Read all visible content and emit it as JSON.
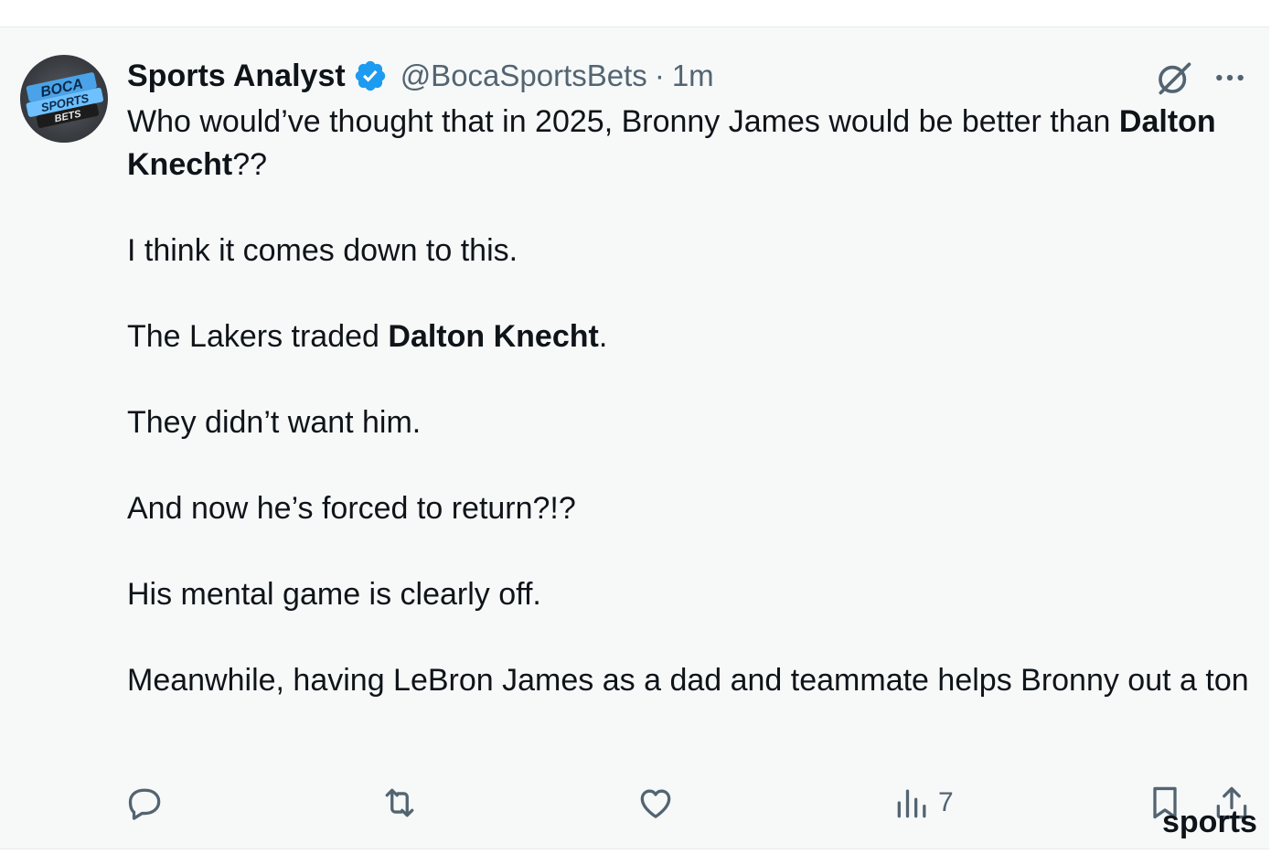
{
  "tweet": {
    "display_name": "Sports Analyst",
    "handle": "@BocaSportsBets",
    "separator": "·",
    "time": "1m",
    "verified": true,
    "avatar_text": [
      "BOCA",
      "SPORTS",
      "BETS"
    ],
    "body": {
      "p1_text": "Who would’ve thought that in 2025, Bronny James would be better than ",
      "p1_bold": "Dalton Knecht",
      "p1_end": "??",
      "p2": "I think it comes down to this.",
      "p3_text": "The Lakers traded ",
      "p3_bold": "Dalton Knecht",
      "p3_end": ".",
      "p4": "They didn’t want him.",
      "p5": "And now he’s forced to return?!?",
      "p6": "His mental game is clearly off.",
      "p7": "Meanwhile, having LeBron James as a dad and teammate helps Bronny out a ton"
    },
    "actions": {
      "reply_icon": "reply-icon",
      "retweet_icon": "retweet-icon",
      "like_icon": "heart-icon",
      "views_icon": "views-icon",
      "views_count": "7",
      "bookmark_icon": "bookmark-icon",
      "share_icon": "share-icon"
    }
  },
  "watermark": "sports",
  "colors": {
    "card_bg": "#f7f9f9",
    "text": "#0f1419",
    "secondary": "#536471",
    "verified_blue": "#1d9bf0"
  }
}
